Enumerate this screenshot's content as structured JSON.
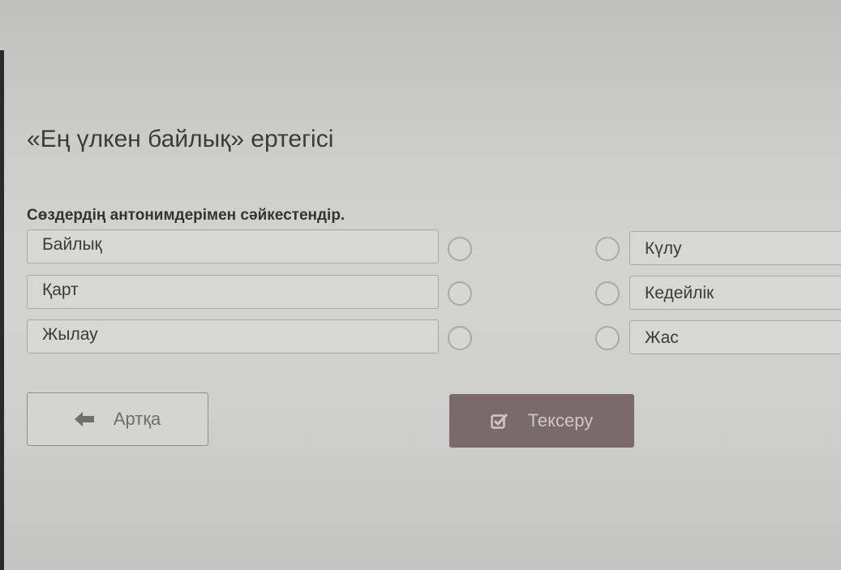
{
  "page": {
    "title": "«Ең үлкен байлық» ертегісі",
    "instruction": "Сөздердің антонимдерімен сәйкестендір."
  },
  "left_items": [
    {
      "label": "Байлық"
    },
    {
      "label": "Қарт"
    },
    {
      "label": "Жылау"
    }
  ],
  "right_items": [
    {
      "label": "Күлу"
    },
    {
      "label": "Кедейлік"
    },
    {
      "label": "Жас"
    }
  ],
  "buttons": {
    "back": {
      "label": "Артқа",
      "icon": "arrow-left-icon"
    },
    "check": {
      "label": "Тексеру",
      "icon": "checkbox-checked-icon"
    }
  },
  "colors": {
    "check_button_bg": "#7a6a6a",
    "back_button_border": "#8e8e8c"
  }
}
